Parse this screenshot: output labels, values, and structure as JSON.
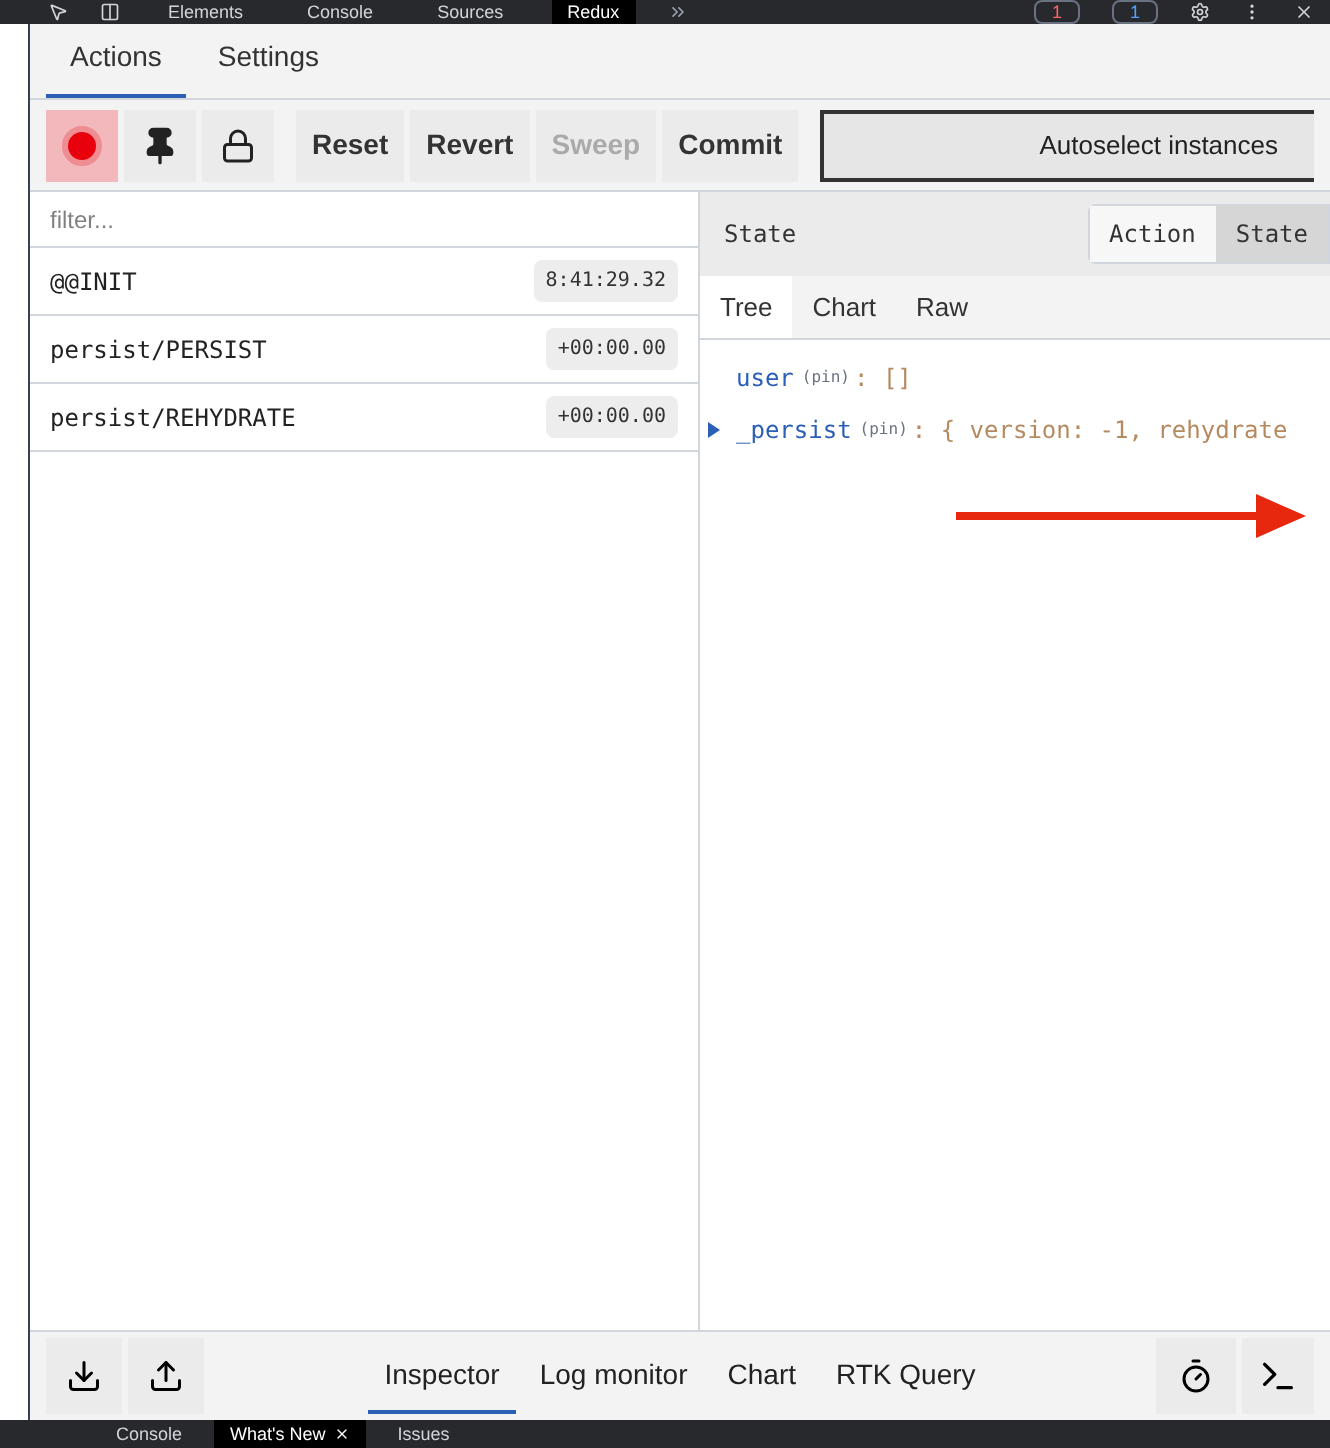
{
  "devtools_tabs": [
    {
      "label": "Elements",
      "selected": false
    },
    {
      "label": "Console",
      "selected": false
    },
    {
      "label": "Sources",
      "selected": false
    },
    {
      "label": "Redux",
      "selected": true
    }
  ],
  "devtools_badges": [
    "1",
    "1"
  ],
  "tabs": [
    {
      "label": "Actions",
      "selected": true
    },
    {
      "label": "Settings",
      "selected": false
    }
  ],
  "toolbar": {
    "recording": true,
    "buttons": [
      {
        "label": "Reset",
        "disabled": false
      },
      {
        "label": "Revert",
        "disabled": false
      },
      {
        "label": "Sweep",
        "disabled": true
      },
      {
        "label": "Commit",
        "disabled": false
      }
    ],
    "instance_select": "Autoselect instances"
  },
  "filter": {
    "placeholder": "filter..."
  },
  "actions": [
    {
      "name": "@@INIT",
      "time": "8:41:29.32"
    },
    {
      "name": "persist/PERSIST",
      "time": "+00:00.00"
    },
    {
      "name": "persist/REHYDRATE",
      "time": "+00:00.00"
    }
  ],
  "inspector": {
    "title": "State",
    "modes": [
      {
        "label": "Action",
        "selected": false
      },
      {
        "label": "State",
        "selected": true
      }
    ],
    "views": [
      {
        "label": "Tree",
        "selected": true
      },
      {
        "label": "Chart",
        "selected": false
      },
      {
        "label": "Raw",
        "selected": false
      }
    ],
    "tree": [
      {
        "key": "user",
        "pin": "(pin)",
        "value": ": []",
        "expandable": false
      },
      {
        "key": "_persist",
        "pin": "(pin)",
        "value": ": { version: -1, rehydrate",
        "expandable": true
      }
    ]
  },
  "monitors": [
    {
      "label": "Inspector",
      "selected": true
    },
    {
      "label": "Log monitor",
      "selected": false
    },
    {
      "label": "Chart",
      "selected": false
    },
    {
      "label": "RTK Query",
      "selected": false
    }
  ],
  "drawer_tabs": [
    {
      "label": "Console",
      "selected": false,
      "closable": false
    },
    {
      "label": "What's New",
      "selected": true,
      "closable": true
    },
    {
      "label": "Issues",
      "selected": false,
      "closable": false
    }
  ]
}
